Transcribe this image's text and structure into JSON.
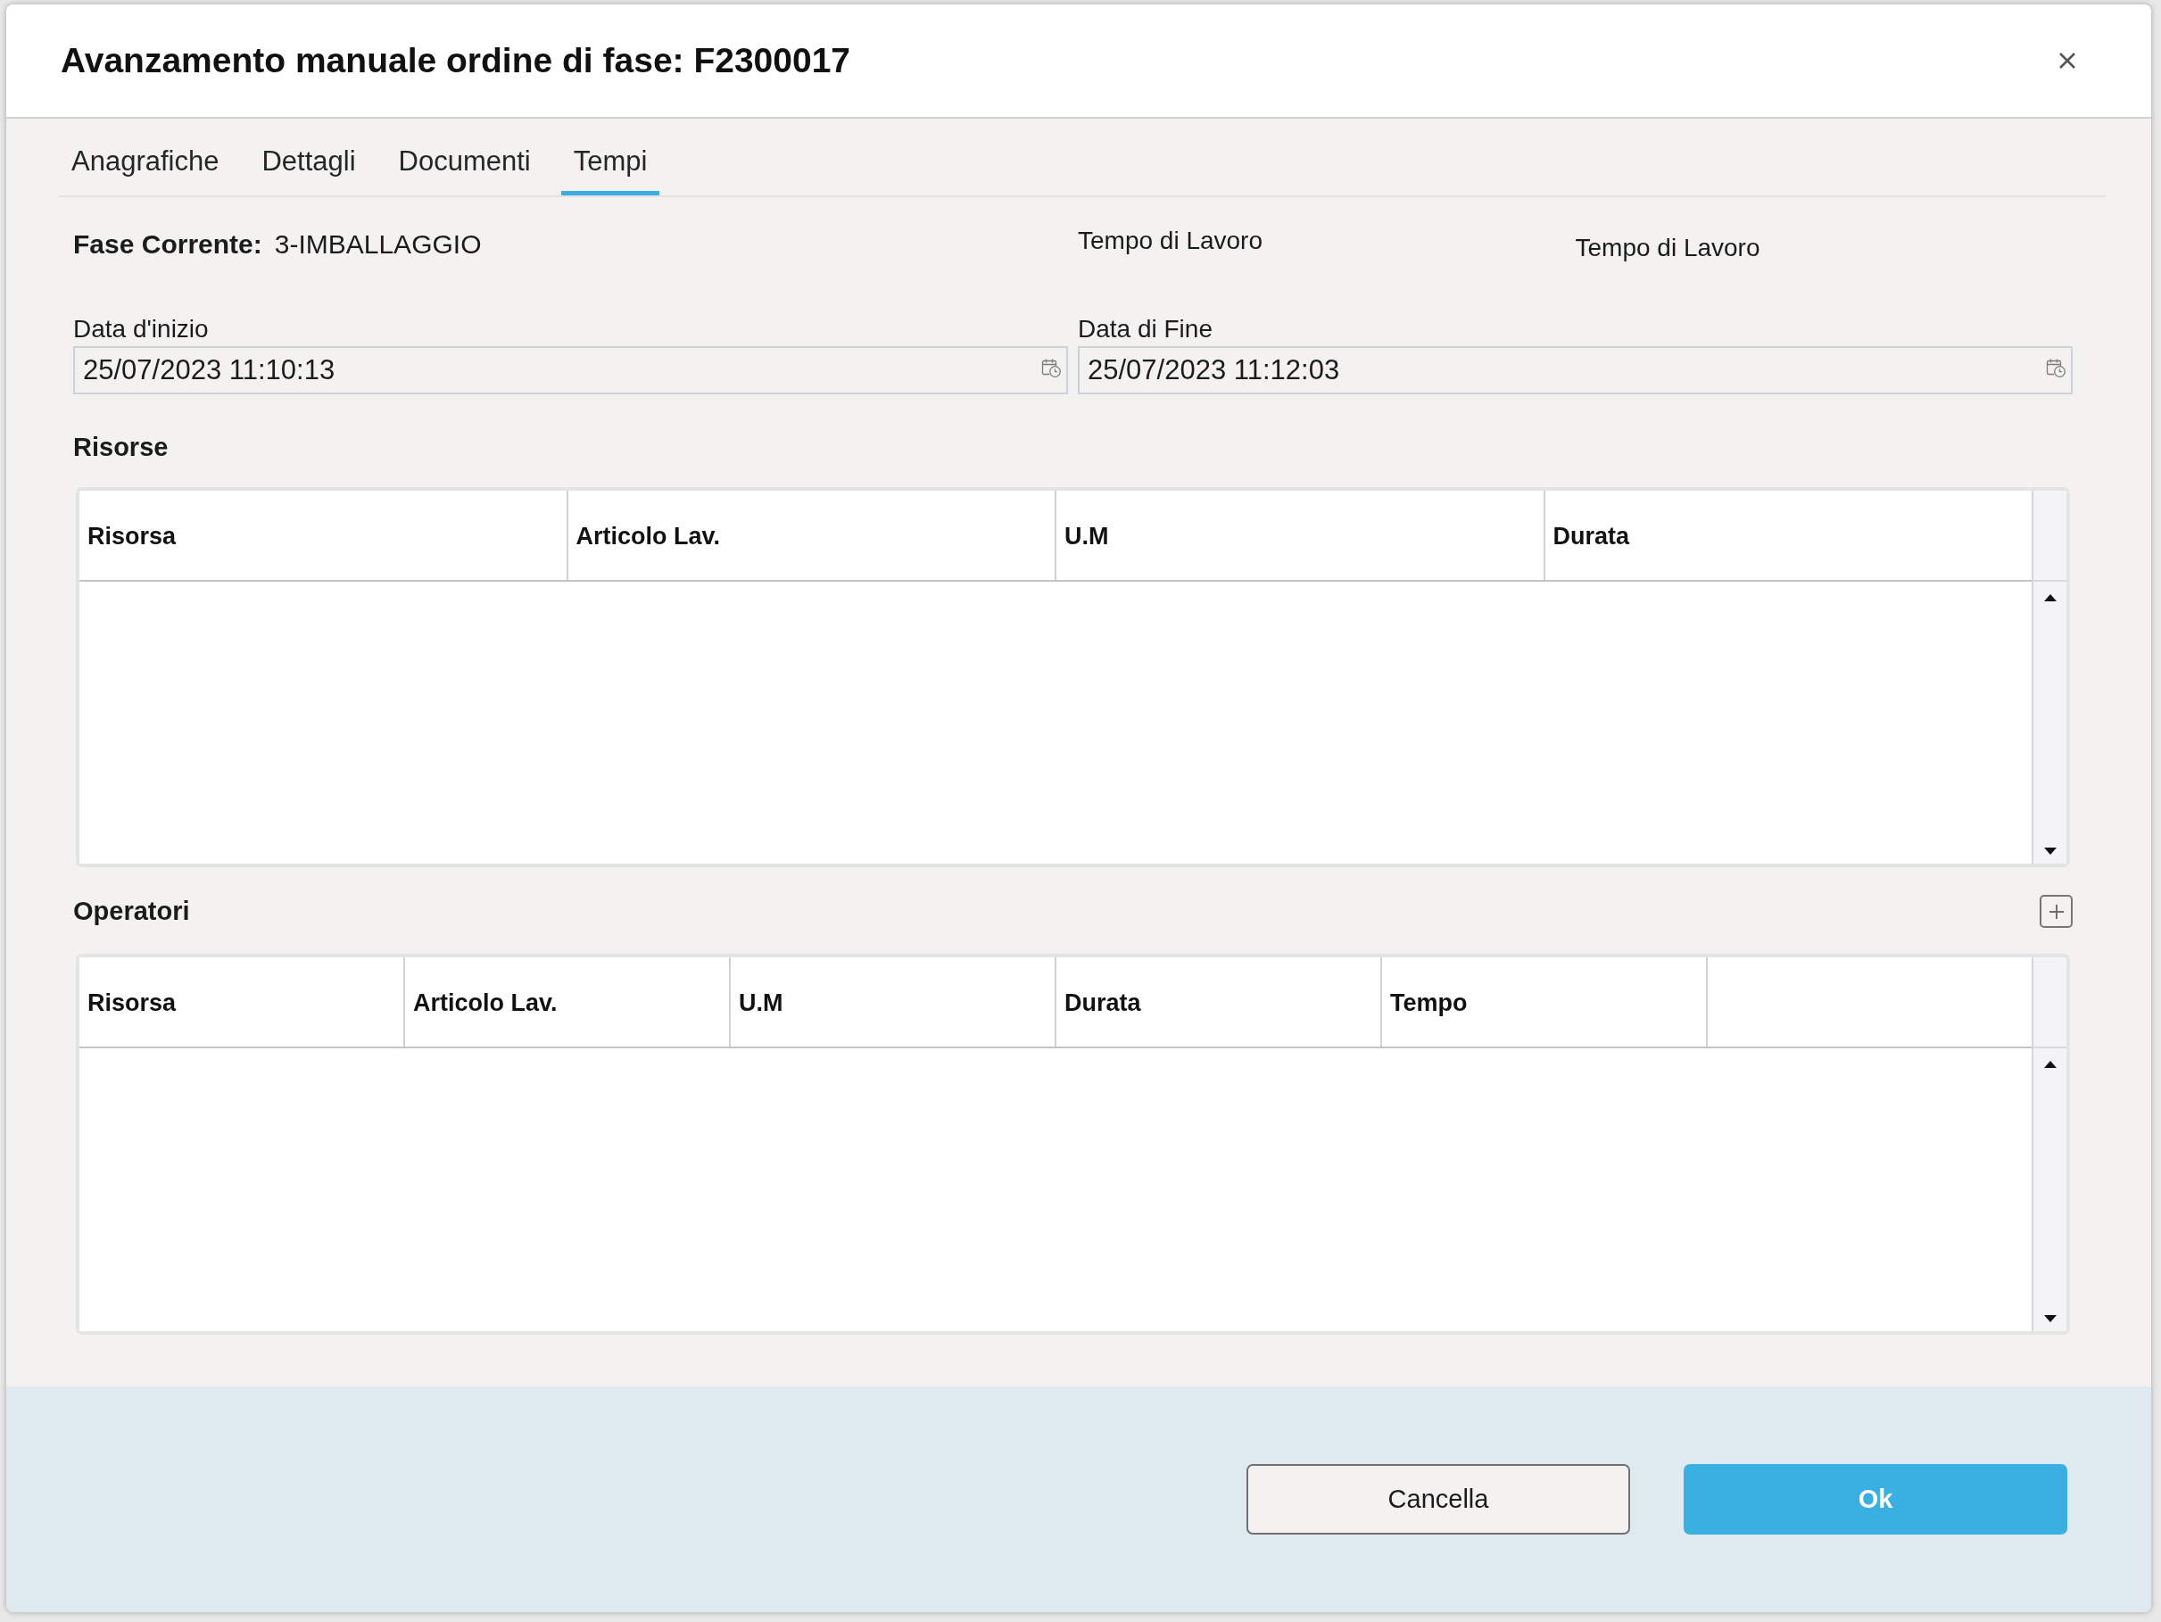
{
  "dialog": {
    "title": "Avanzamento manuale ordine di fase: F2300017"
  },
  "tabs": [
    {
      "label": "Anagrafiche",
      "selected": false
    },
    {
      "label": "Dettagli",
      "selected": false
    },
    {
      "label": "Documenti",
      "selected": false
    },
    {
      "label": "Tempi",
      "selected": true
    }
  ],
  "current_phase": {
    "label": "Fase Corrente:",
    "value": "3-IMBALLAGGIO"
  },
  "work_time_labels": [
    "Tempo di Lavoro",
    "Tempo di Lavoro"
  ],
  "dates": [
    {
      "label": "Data d'inizio",
      "value": "25/07/2023 11:10:13"
    },
    {
      "label": "Data di Fine",
      "value": "25/07/2023 11:12:03"
    }
  ],
  "resources": {
    "title": "Risorse",
    "columns": [
      {
        "kind": "heading",
        "label": "Risorsa"
      },
      {
        "kind": "heading",
        "label": "Articolo Lav."
      },
      {
        "kind": "heading",
        "label": "U.M"
      },
      {
        "kind": "heading",
        "label": "Durata"
      }
    ]
  },
  "operators": {
    "title": "Operatori",
    "columns": [
      {
        "kind": "heading",
        "label": "Risorsa"
      },
      {
        "kind": "heading",
        "label": "Articolo Lav."
      },
      {
        "kind": "heading",
        "label": "U.M"
      },
      {
        "kind": "heading",
        "label": "Durata"
      },
      {
        "kind": "heading",
        "label": "Tempo"
      },
      {
        "kind": "blank"
      }
    ]
  },
  "buttons": [
    {
      "kind": "secondary",
      "label": "Cancella"
    },
    {
      "kind": "primary",
      "label": "Ok"
    }
  ]
}
